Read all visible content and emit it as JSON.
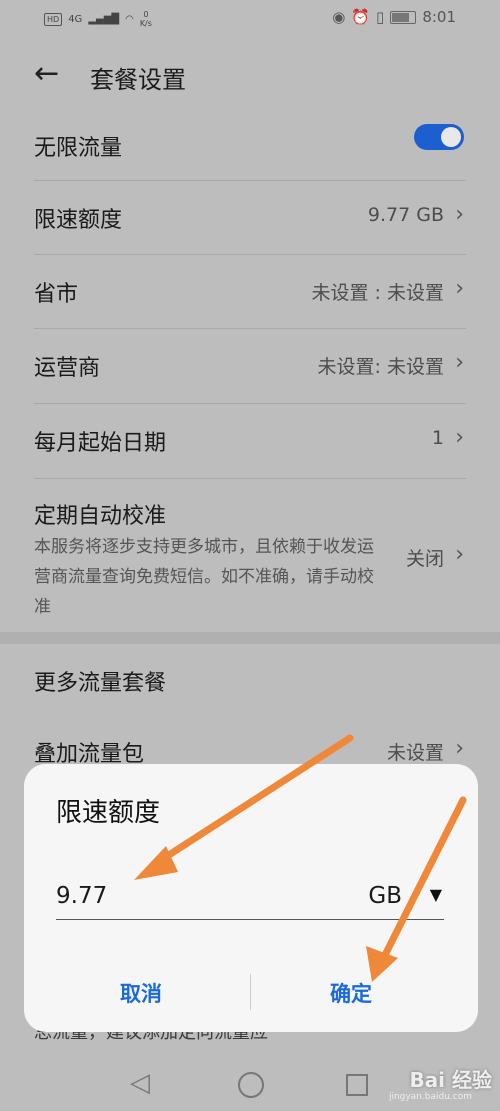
{
  "status_bar": {
    "hd_badge": "HD",
    "network": "4G",
    "speed_value": "0",
    "speed_unit": "K/s",
    "time": "8:01"
  },
  "header": {
    "title": "套餐设置"
  },
  "settings": {
    "unlimited": {
      "label": "无限流量",
      "enabled": true
    },
    "speed_limit": {
      "label": "限速额度",
      "value": "9.77 GB"
    },
    "province": {
      "label": "省市",
      "value": "未设置 : 未设置"
    },
    "carrier": {
      "label": "运营商",
      "value": "未设置: 未设置"
    },
    "start_day": {
      "label": "每月起始日期",
      "value": "1"
    },
    "auto_calibrate": {
      "label": "定期自动校准",
      "description": "本服务将逐步支持更多城市，且依赖于收发运营商流量查询免费短信。如不准确，请手动校准",
      "value": "关闭"
    }
  },
  "more_section": {
    "title": "更多流量套餐",
    "addon": {
      "label": "叠加流量包",
      "value": "未设置"
    },
    "partial_text": "总流量，建议添加定向流量应"
  },
  "dialog": {
    "title": "限速额度",
    "input_value": "9.77",
    "unit": "GB",
    "cancel": "取消",
    "confirm": "确定"
  },
  "watermark": {
    "brand": "Bai 经验",
    "site": "jingyan.baidu.com"
  },
  "colors": {
    "accent": "#1b5fd1",
    "dialog_button": "#1a6bd9",
    "arrow": "#f0883a"
  }
}
